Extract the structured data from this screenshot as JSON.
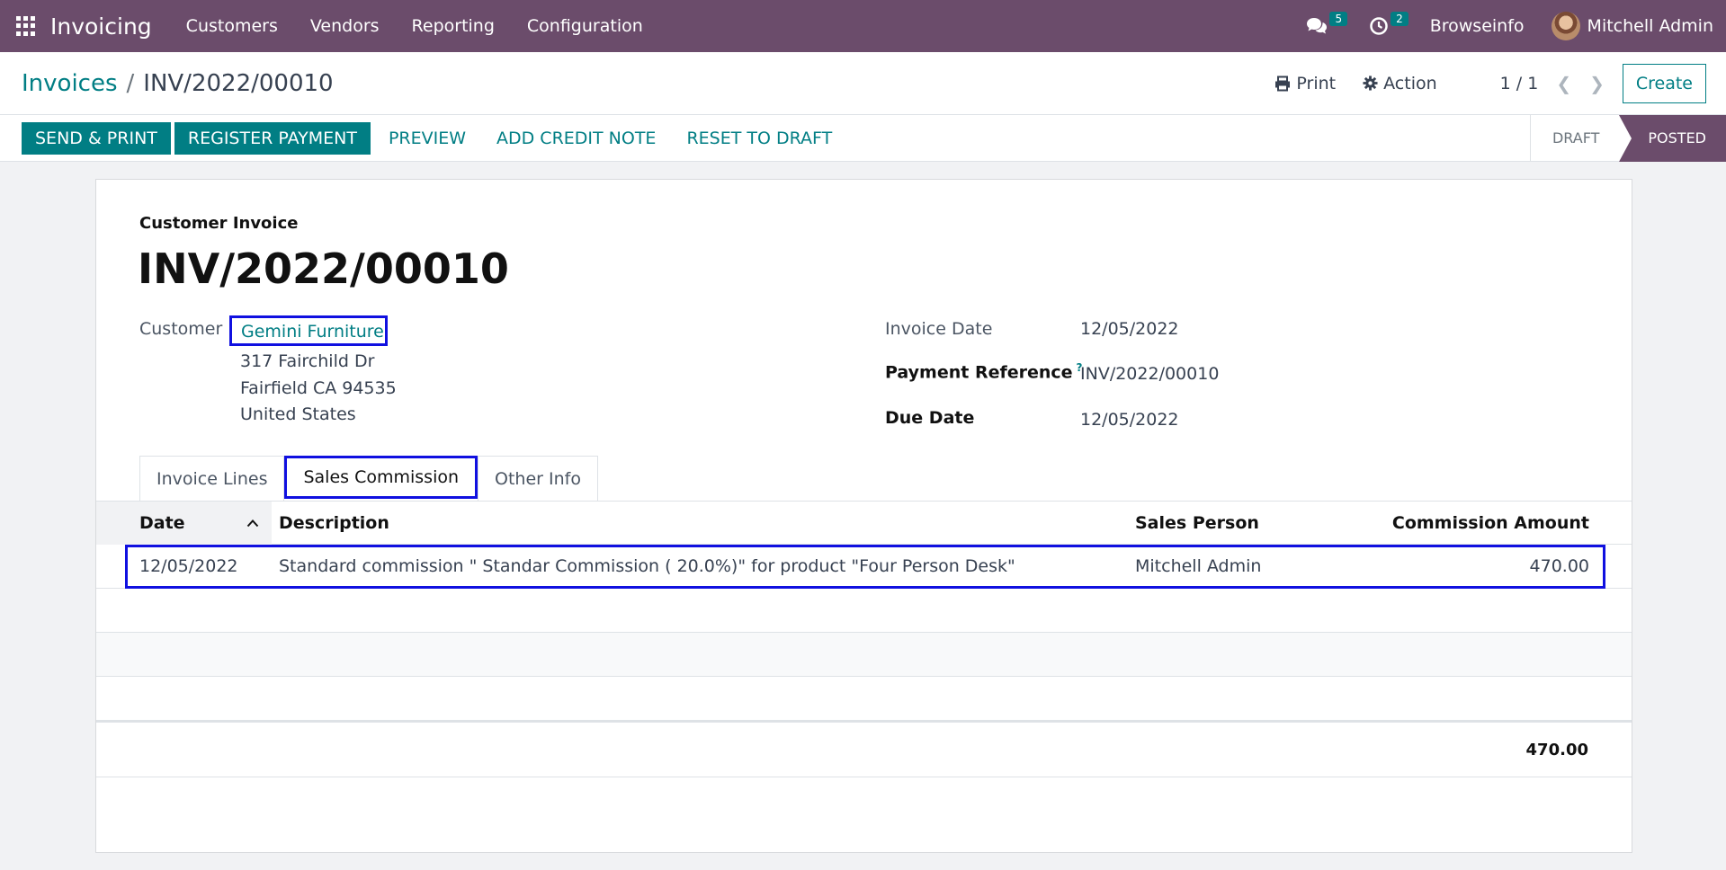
{
  "navbar": {
    "app_name": "Invoicing",
    "menu": [
      "Customers",
      "Vendors",
      "Reporting",
      "Configuration"
    ],
    "messages_count": "5",
    "activities_count": "2",
    "company": "Browseinfo",
    "user": "Mitchell Admin"
  },
  "control_panel": {
    "breadcrumb_parent": "Invoices",
    "breadcrumb_separator": "/",
    "breadcrumb_current": "INV/2022/00010",
    "print_label": "Print",
    "action_label": "Action",
    "pager": "1 / 1",
    "create_label": "Create"
  },
  "statusbar": {
    "buttons_primary": [
      "SEND & PRINT",
      "REGISTER PAYMENT"
    ],
    "buttons_link": [
      "PREVIEW",
      "ADD CREDIT NOTE",
      "RESET TO DRAFT"
    ],
    "steps": [
      "DRAFT",
      "POSTED"
    ],
    "active_step": "POSTED"
  },
  "sheet": {
    "doc_type": "Customer Invoice",
    "doc_name": "INV/2022/00010",
    "customer_label": "Customer",
    "customer_name": "Gemini Furniture",
    "address_line1": "317 Fairchild Dr",
    "address_line2": "Fairfield CA 94535",
    "address_line3": "United States",
    "invoice_date_label": "Invoice Date",
    "invoice_date": "12/05/2022",
    "payment_ref_label": "Payment Reference",
    "payment_ref_help": "?",
    "payment_ref": "INV/2022/00010",
    "due_date_label": "Due Date",
    "due_date": "12/05/2022"
  },
  "tabs": [
    "Invoice Lines",
    "Sales Commission",
    "Other Info"
  ],
  "active_tab": "Sales Commission",
  "table": {
    "columns": {
      "date": "Date",
      "description": "Description",
      "sales_person": "Sales Person",
      "amount": "Commission Amount"
    },
    "rows": [
      {
        "date": "12/05/2022",
        "description": "Standard commission \" Standar Commission ( 20.0%)\" for product \"Four Person Desk\"",
        "sales_person": "Mitchell Admin",
        "amount": "470.00"
      }
    ],
    "total": "470.00"
  },
  "colors": {
    "brand": "#6b4c6b",
    "accent": "#017e84",
    "highlight": "#1010e0"
  }
}
